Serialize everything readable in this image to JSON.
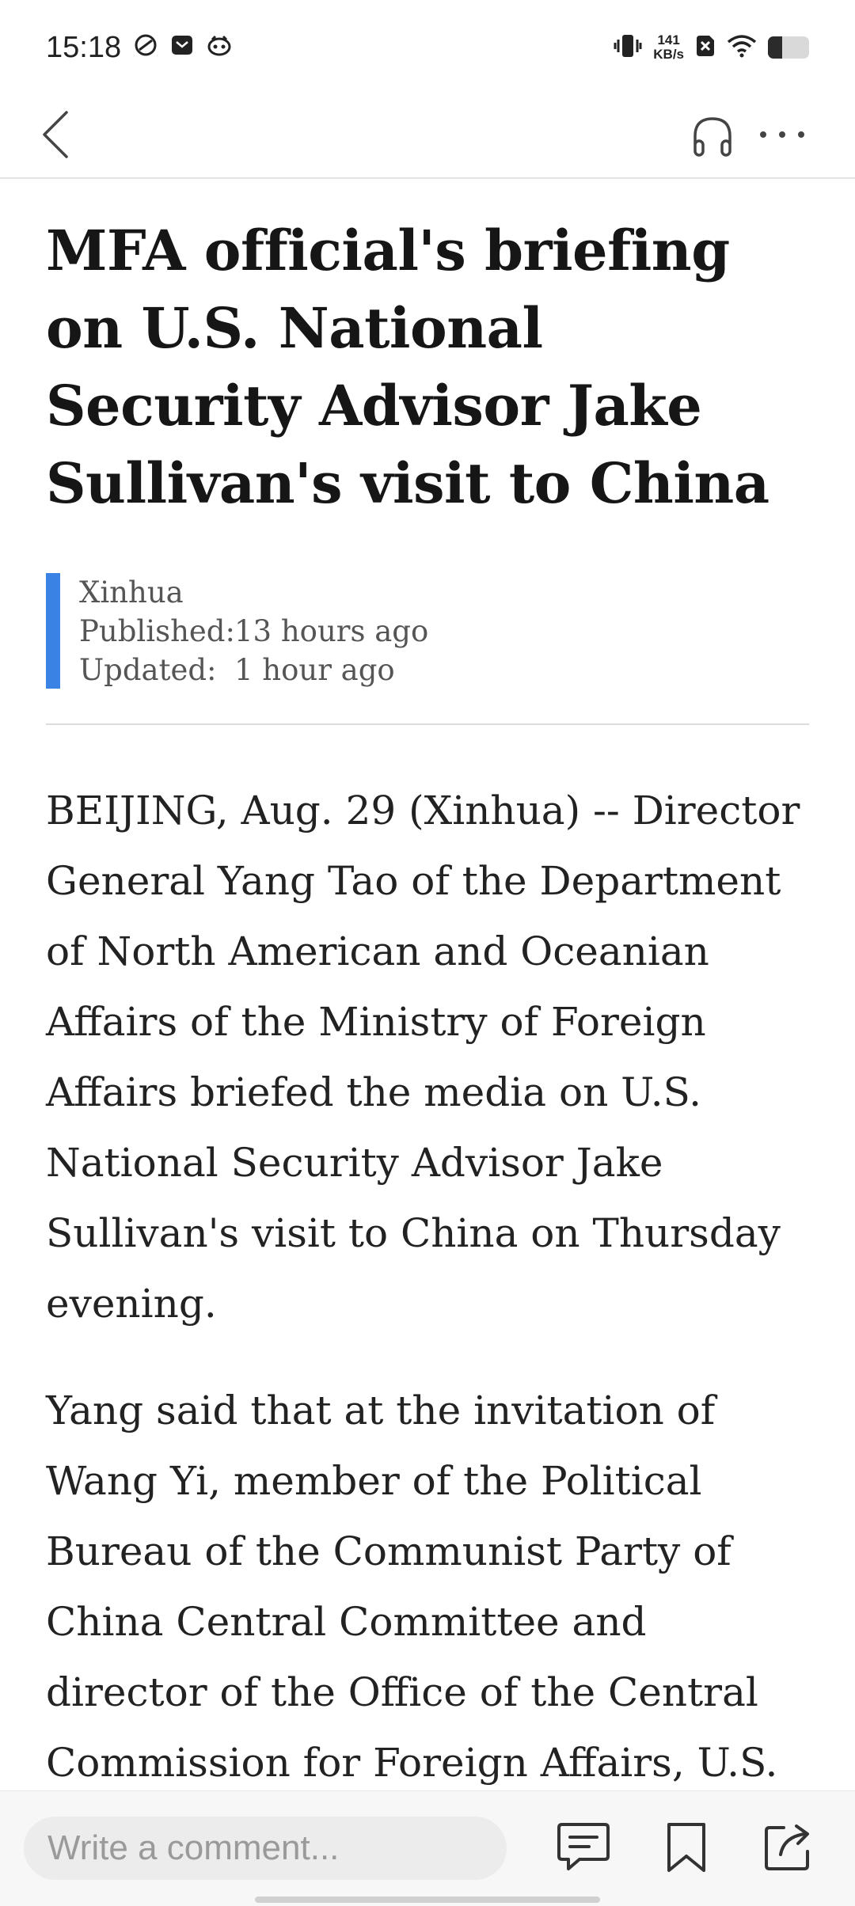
{
  "status_bar": {
    "time": "15:18",
    "net_speed_value": "141",
    "net_speed_unit": "KB/s",
    "battery_level": 0.35,
    "icons": [
      "dnd-icon",
      "message-icon",
      "app-notification-icon",
      "vibrate-icon",
      "no-sim-icon",
      "wifi-icon",
      "battery-icon"
    ]
  },
  "app_bar": {
    "icons": [
      "back-arrow-icon",
      "headphones-icon",
      "more-dots-icon"
    ]
  },
  "article": {
    "headline": "MFA official's briefing on U.S. National Security Advisor Jake Sullivan's visit to China",
    "source": "Xinhua",
    "published_label": "Published:",
    "published_value": "13 hours ago",
    "updated_label": "Updated:",
    "updated_value": "1 hour ago",
    "paragraphs": [
      "BEIJING, Aug. 29 (Xinhua) -- Director General Yang Tao of the Department of North American and Oceanian Affairs of the Ministry of Foreign Affairs briefed the media on U.S. National Security Advisor Jake Sullivan's visit to China on Thursday evening.",
      "Yang said that at the invitation of Wang Yi, member of the Political Bureau of the Communist Party of China Central Committee and director of the Office of the Central Commission for Foreign Affairs, U.S."
    ]
  },
  "bottom_bar": {
    "comment_placeholder": "Write a comment...",
    "icons": [
      "comments-icon",
      "bookmark-icon",
      "share-icon"
    ]
  },
  "colors": {
    "accent": "#3a82e4",
    "text": "#1a1a1a",
    "muted": "#555555"
  }
}
